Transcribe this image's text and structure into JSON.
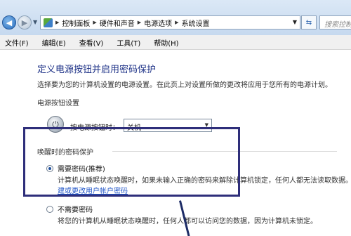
{
  "address_bar": {
    "crumbs": [
      "控制面板",
      "硬件和声音",
      "电源选项",
      "系统设置"
    ],
    "search_placeholder": "搜索控制面"
  },
  "menu": [
    "文件(F)",
    "编辑(E)",
    "查看(V)",
    "工具(T)",
    "帮助(H)"
  ],
  "page": {
    "title": "定义电源按钮并启用密码保护",
    "description": "选择要为您的计算机设置的电源设置。在此页上对设置所做的更改将应用于您所有的电源计划。",
    "power_section": "电源按钮设置",
    "power_label": "按电源按钮时：",
    "power_value": "关机",
    "wake_section": "唤醒时的密码保护",
    "option1": {
      "label": "需要密码(推荐)",
      "desc": "计算机从睡眠状态唤醒时，如果未输入正确的密码来解除计算机锁定，任何人都无法读取数据。",
      "link": "建或更改用户帐户密码",
      "selected": true
    },
    "option2": {
      "label": "不需要密码",
      "desc": "将您的计算机从睡眠状态唤醒时，任何人都可以访问您的数据，因为计算机未锁定。",
      "selected": false
    }
  },
  "colors": {
    "title": "#1e3287",
    "link": "#1f54c7",
    "annotation": "#2e2e7a"
  }
}
